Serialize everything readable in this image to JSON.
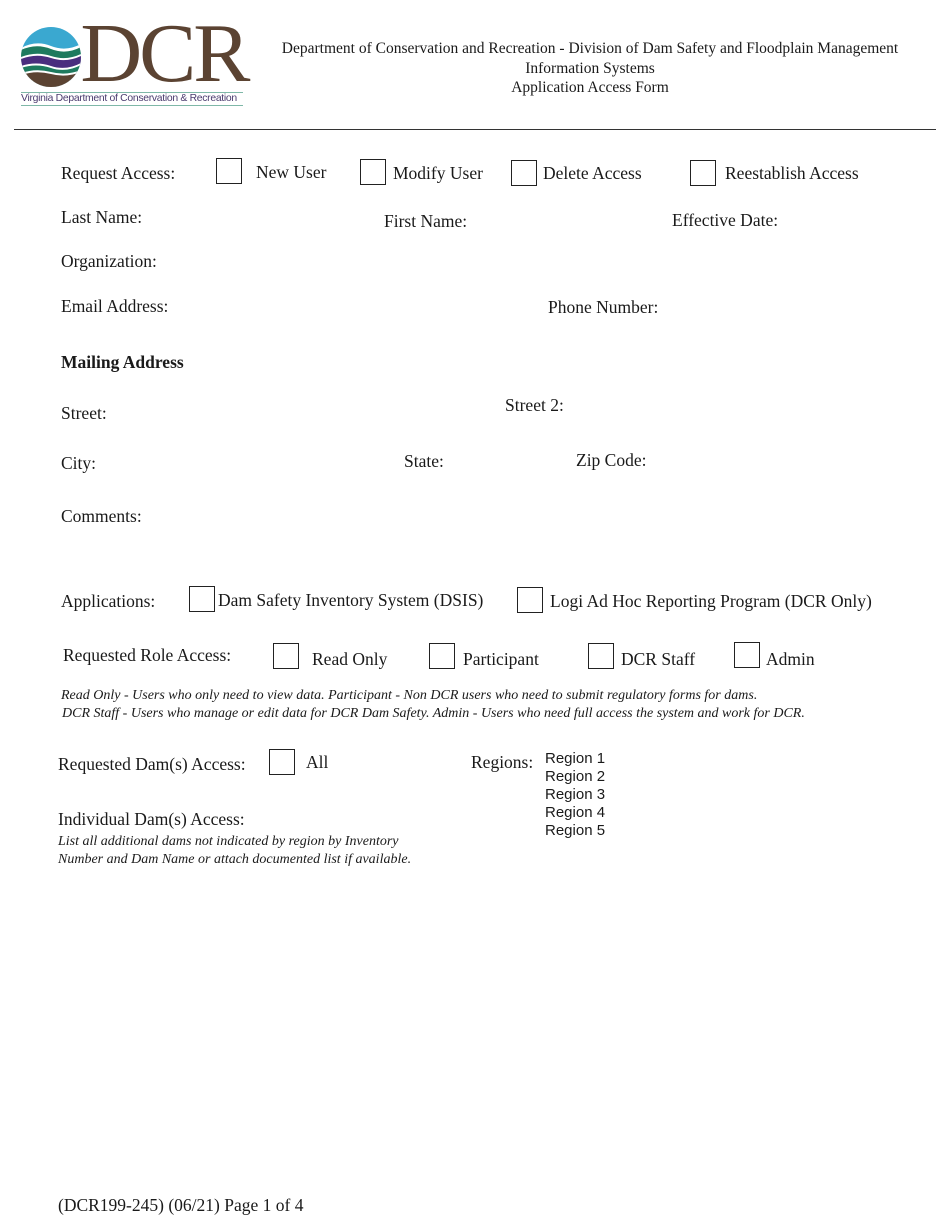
{
  "logo": {
    "mark": "DCR",
    "subtitle": "Virginia Department of Conservation & Recreation",
    "colors": {
      "sky": "#3aa8d0",
      "green": "#1e7a5e",
      "purple": "#4a2d7e",
      "earth": "#5b4332"
    }
  },
  "header": {
    "line1": "Department of Conservation and Recreation - Division of Dam Safety and Floodplain Management",
    "line2": "Information Systems",
    "line3": "Application Access Form"
  },
  "request_access": {
    "label": "Request Access:",
    "options": [
      {
        "label": "New User",
        "checked": false
      },
      {
        "label": "Modify User",
        "checked": false
      },
      {
        "label": "Delete Access",
        "checked": false
      },
      {
        "label": "Reestablish Access",
        "checked": false
      }
    ]
  },
  "fields": {
    "last_name": {
      "label": "Last Name:",
      "value": ""
    },
    "first_name": {
      "label": "First Name:",
      "value": ""
    },
    "effective_date": {
      "label": "Effective Date:",
      "value": ""
    },
    "organization": {
      "label": "Organization:",
      "value": ""
    },
    "email": {
      "label": "Email Address:",
      "value": ""
    },
    "phone": {
      "label": "Phone Number:",
      "value": ""
    }
  },
  "mailing": {
    "heading": "Mailing Address",
    "street": {
      "label": "Street:",
      "value": ""
    },
    "street2": {
      "label": "Street 2:",
      "value": ""
    },
    "city": {
      "label": "City:",
      "value": ""
    },
    "state": {
      "label": "State:",
      "value": ""
    },
    "zip": {
      "label": "Zip Code:",
      "value": ""
    },
    "comments": {
      "label": "Comments:",
      "value": ""
    }
  },
  "applications": {
    "label": "Applications:",
    "options": [
      {
        "label": "Dam Safety Inventory System (DSIS)",
        "checked": false
      },
      {
        "label": "Logi Ad Hoc Reporting Program (DCR Only)",
        "checked": false
      }
    ]
  },
  "roles": {
    "label": "Requested Role Access:",
    "options": [
      {
        "label": "Read Only",
        "checked": false
      },
      {
        "label": "Participant",
        "checked": false
      },
      {
        "label": "DCR Staff",
        "checked": false
      },
      {
        "label": "Admin",
        "checked": false
      }
    ],
    "note_line1": "Read Only - Users who only need to view data.   Participant - Non DCR users who need to submit regulatory forms for dams.",
    "note_line2": "DCR Staff - Users who manage or edit data for DCR Dam Safety.   Admin - Users who need full access the system and work for DCR."
  },
  "dams": {
    "label": "Requested Dam(s) Access:",
    "all_label": "All",
    "all_checked": false,
    "regions_label": "Regions:",
    "regions": [
      "Region 1",
      "Region 2",
      "Region 3",
      "Region 4",
      "Region 5"
    ],
    "individual_label": "Individual Dam(s) Access:",
    "individual_note_line1": "List all additional dams not indicated by region by Inventory",
    "individual_note_line2": "Number and Dam Name or attach documented list if available."
  },
  "footer": {
    "text": "(DCR199-245) (06/21) Page 1 of 4"
  }
}
